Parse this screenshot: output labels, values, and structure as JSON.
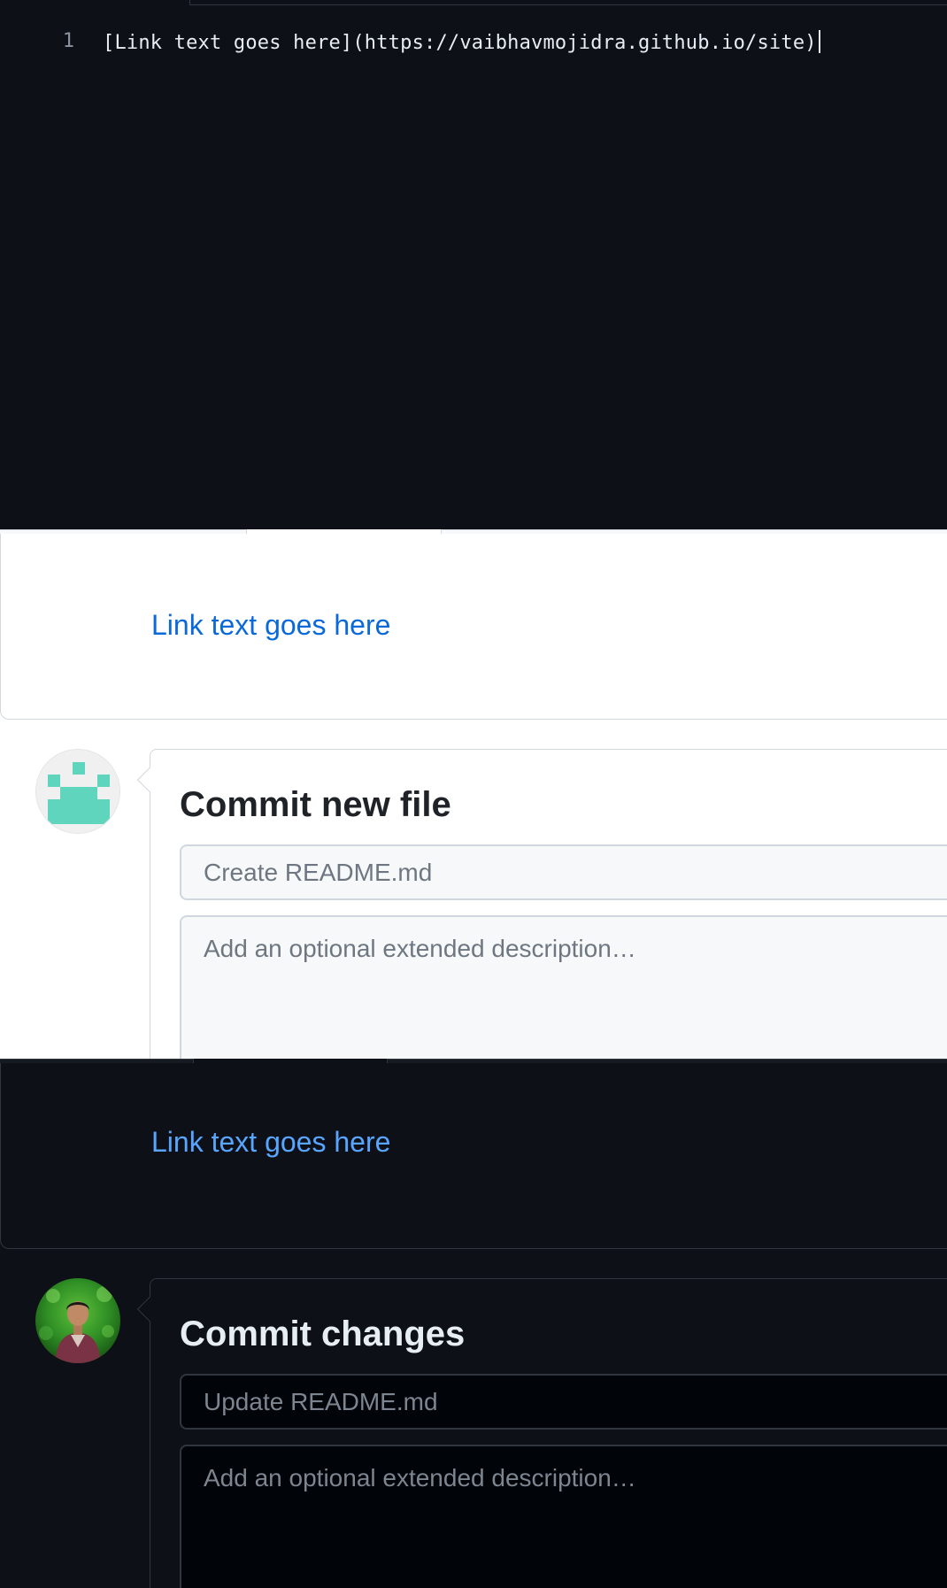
{
  "editor": {
    "line_number": "1",
    "code_line": "[Link text goes here](https://vaibhavmojidra.github.io/site)"
  },
  "light_mode": {
    "preview_link_text": "Link text goes here",
    "commit_title": "Commit new file",
    "summary_placeholder": "Create README.md",
    "description_placeholder": "Add an optional extended description…",
    "avatar_icon": "identicon-avatar",
    "colors": {
      "link": "#0969da",
      "identicon": "#5fd5bd"
    }
  },
  "dark_mode": {
    "preview_link_text": "Link text goes here",
    "commit_title": "Commit changes",
    "summary_placeholder": "Update README.md",
    "description_placeholder": "Add an optional extended description…",
    "avatar_icon": "user-photo-avatar",
    "colors": {
      "link": "#58a6ff",
      "background": "#0d1117"
    }
  }
}
